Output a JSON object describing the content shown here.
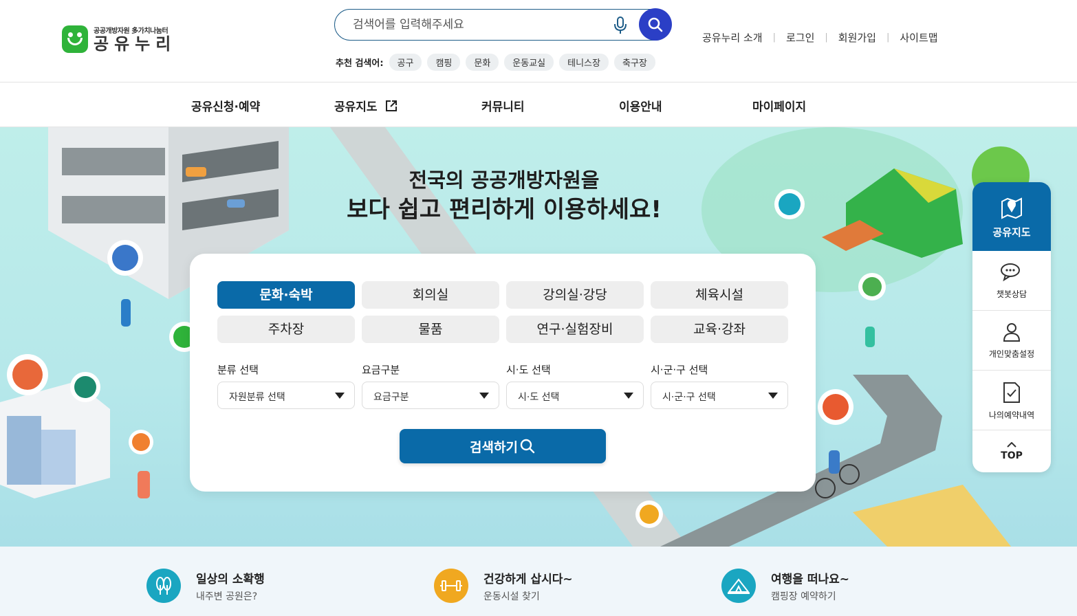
{
  "header": {
    "logo": {
      "sub": "공공개방자원 多가치나눔터",
      "main": "공유누리"
    },
    "search": {
      "placeholder": "검색어를 입력해주세요"
    },
    "recommended": {
      "label": "추천 검색어:",
      "tags": [
        "공구",
        "캠핑",
        "문화",
        "운동교실",
        "테니스장",
        "축구장"
      ]
    },
    "util_links": [
      "공유누리 소개",
      "로그인",
      "회원가입",
      "사이트맵"
    ]
  },
  "nav": {
    "items": [
      "공유신청·예약",
      "공유지도",
      "커뮤니티",
      "이용안내",
      "마이페이지"
    ]
  },
  "hero": {
    "title_line1": "전국의 공공개방자원을",
    "title_line2": "보다 쉽고 편리하게 이용하세요!"
  },
  "search_card": {
    "categories": [
      "문화·숙박",
      "회의실",
      "강의실·강당",
      "체육시설",
      "주차장",
      "물품",
      "연구·실험장비",
      "교육·강좌"
    ],
    "active_category": "문화·숙박",
    "filters": [
      {
        "label": "분류 선택",
        "value": "자원분류 선택"
      },
      {
        "label": "요금구분",
        "value": "요금구분"
      },
      {
        "label": "시·도 선택",
        "value": "시·도 선택"
      },
      {
        "label": "시·군·구 선택",
        "value": "시·군·구 선택"
      }
    ],
    "submit_label": "검색하기"
  },
  "quick_menu": {
    "main": "공유지도",
    "items": [
      "챗봇상담",
      "개인맞춤설정",
      "나의예약내역"
    ],
    "top": "TOP"
  },
  "bottom": [
    {
      "title": "일상의 소확행",
      "sub": "내주변 공원은?",
      "color": "#1aa6c1"
    },
    {
      "title": "건강하게 삽시다~",
      "sub": "운동시설 찾기",
      "color": "#f0a820"
    },
    {
      "title": "여행을 떠나요~",
      "sub": "캠핑장 예약하기",
      "color": "#1aa6c1"
    }
  ],
  "colors": {
    "primary": "#0a6aa8",
    "search_button": "#2b3fc6",
    "logo_green": "#2fb33a"
  }
}
